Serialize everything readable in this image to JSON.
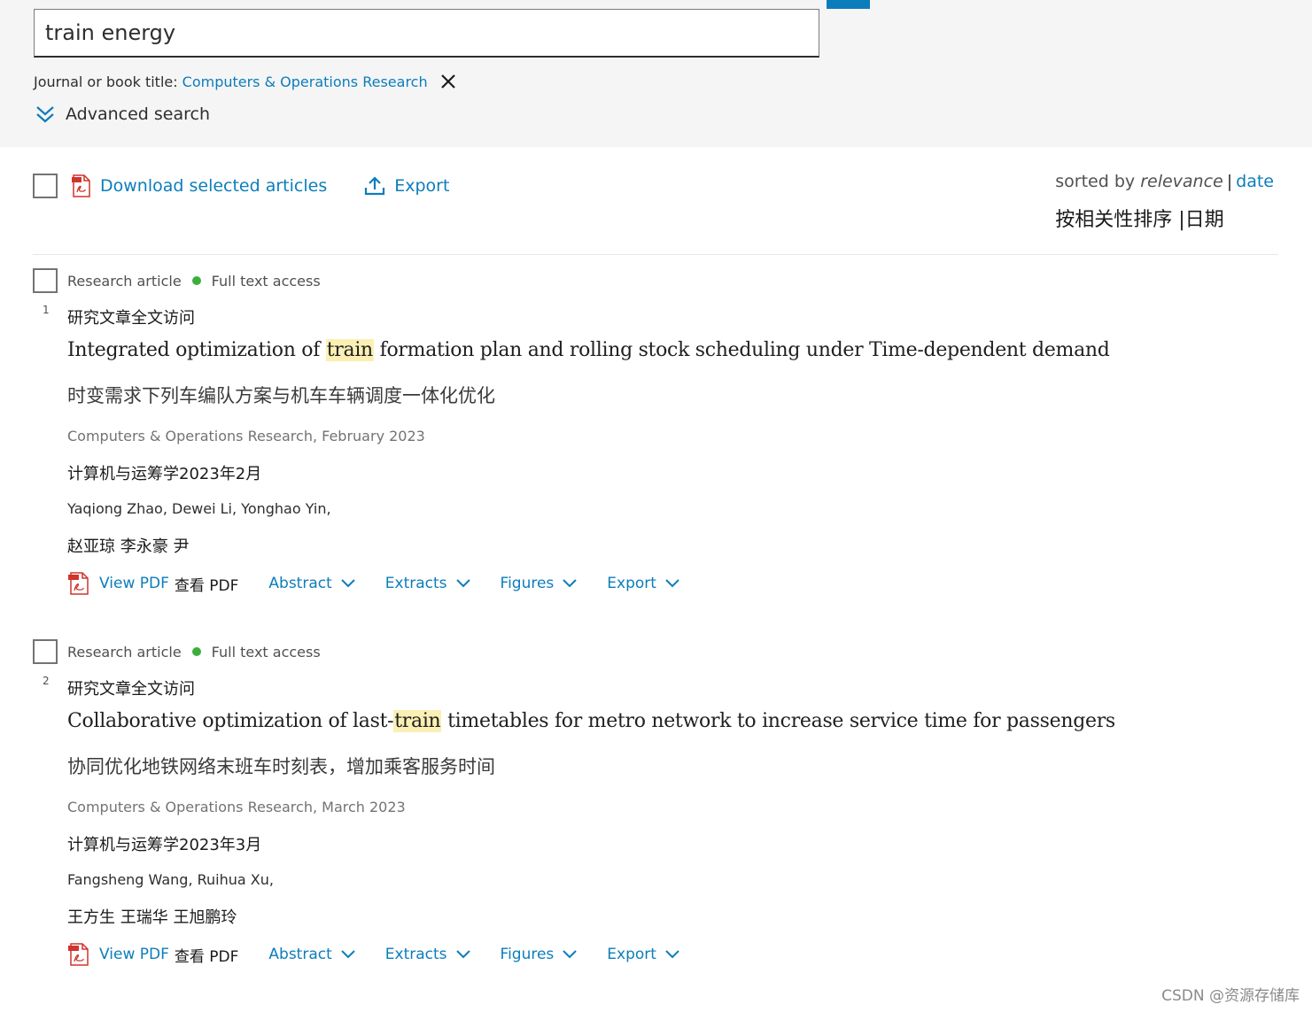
{
  "search": {
    "query": "train energy"
  },
  "filter": {
    "label": "Journal or book title:",
    "value": "Computers & Operations Research"
  },
  "advanced_search_label": "Advanced search",
  "toolbar": {
    "download_label": "Download selected articles",
    "export_label": "Export"
  },
  "sort": {
    "prefix": "sorted by",
    "relevance": "relevance",
    "separator": "|",
    "date": "date",
    "zh": "按相关性排序 |日期"
  },
  "results": [
    {
      "number": "1",
      "type": "Research article",
      "access": "Full text access",
      "zh_meta": "研究文章全文访问",
      "title_before": "Integrated optimization of ",
      "title_highlight": "train",
      "title_after": " formation plan and rolling stock scheduling under Time-dependent demand",
      "zh_title": "时变需求下列车编队方案与机车车辆调度一体化优化",
      "source": "Computers & Operations Research, February 2023",
      "zh_source": "计算机与运筹学2023年2月",
      "authors": "Yaqiong Zhao, Dewei Li, Yonghao Yin,",
      "zh_authors": "赵亚琼 李永豪 尹",
      "actions": {
        "view_pdf": "View PDF",
        "view_pdf_zh": "查看 PDF",
        "abstract": "Abstract",
        "extracts": "Extracts",
        "figures": "Figures",
        "export": "Export"
      }
    },
    {
      "number": "2",
      "type": "Research article",
      "access": "Full text access",
      "zh_meta": "研究文章全文访问",
      "title_before": "Collaborative optimization of last-",
      "title_highlight": "train",
      "title_after": " timetables for metro network to increase service time for passengers",
      "zh_title": "协同优化地铁网络末班车时刻表，增加乘客服务时间",
      "source": "Computers & Operations Research, March 2023",
      "zh_source": "计算机与运筹学2023年3月",
      "authors": "Fangsheng Wang, Ruihua Xu,",
      "zh_authors": "王方生 王瑞华 王旭鹏玲",
      "actions": {
        "view_pdf": "View PDF",
        "view_pdf_zh": "查看 PDF",
        "abstract": "Abstract",
        "extracts": "Extracts",
        "figures": "Figures",
        "export": "Export"
      }
    }
  ],
  "watermark": "CSDN @资源存储库",
  "colors": {
    "link": "#0c7dbb",
    "access_dot": "#3dae3d",
    "highlight": "#fbf0b4",
    "panel_bg": "#f5f5f5"
  }
}
